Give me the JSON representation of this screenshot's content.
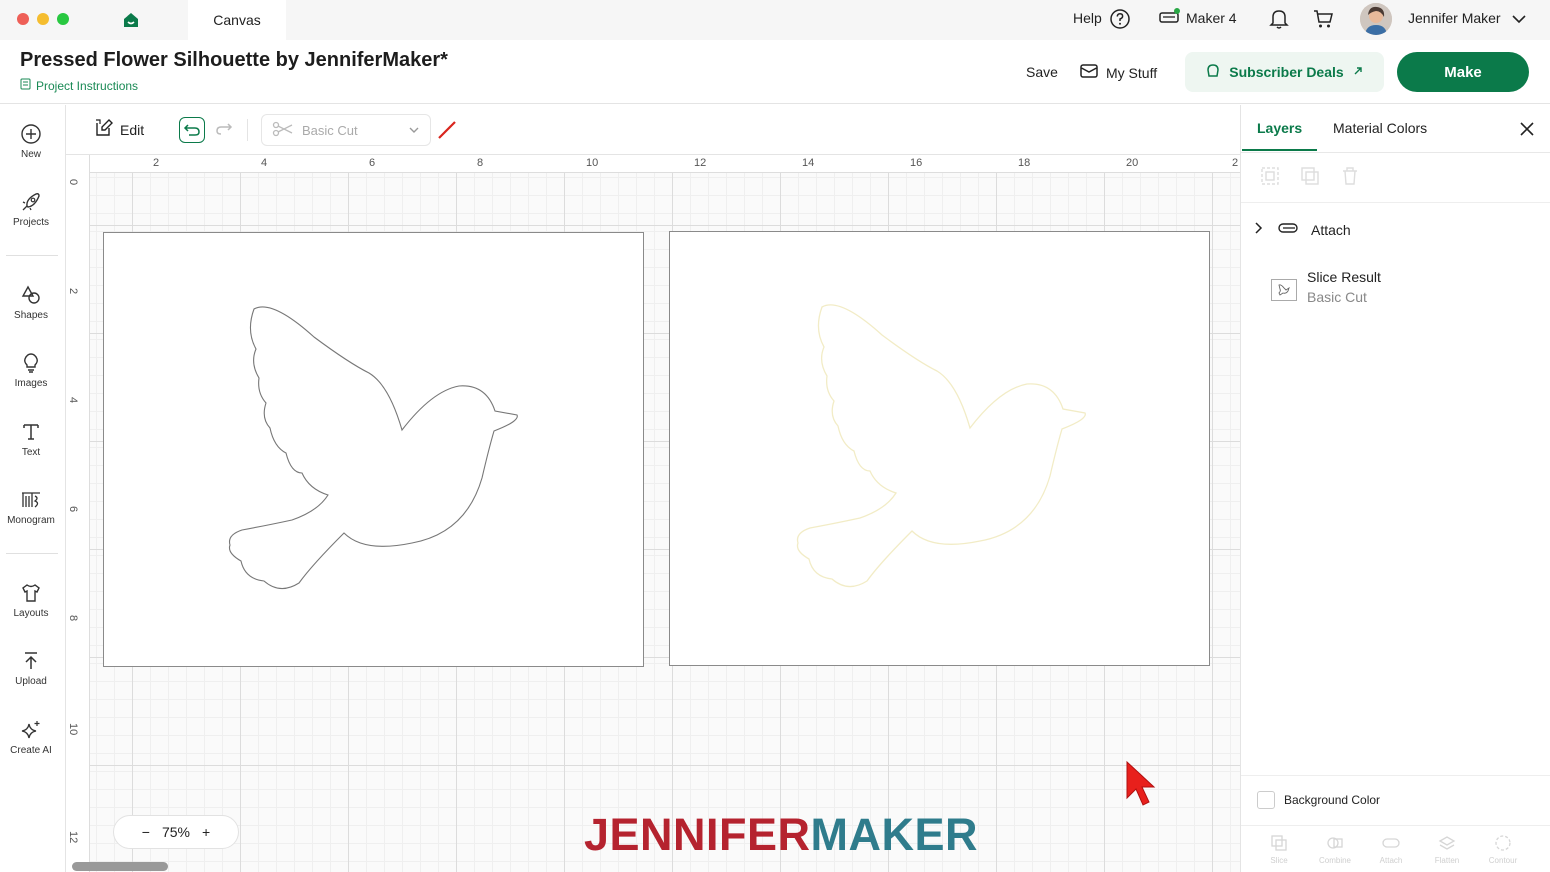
{
  "window": {
    "tab_label": "Canvas",
    "help_label": "Help",
    "machine_label": "Maker 4",
    "user_name": "Jennifer Maker"
  },
  "header": {
    "project_title": "Pressed Flower Silhouette by JenniferMaker*",
    "project_instructions": "Project Instructions",
    "save_label": "Save",
    "my_stuff_label": "My Stuff",
    "subscriber_deals_label": "Subscriber Deals",
    "make_label": "Make"
  },
  "sidebar": {
    "items": [
      {
        "label": "New",
        "icon": "plus-circle-icon"
      },
      {
        "label": "Projects",
        "icon": "rocket-icon"
      },
      {
        "label": "Shapes",
        "icon": "shapes-icon"
      },
      {
        "label": "Images",
        "icon": "lightbulb-icon"
      },
      {
        "label": "Text",
        "icon": "text-icon"
      },
      {
        "label": "Monogram",
        "icon": "monogram-icon"
      },
      {
        "label": "Layouts",
        "icon": "tshirt-icon"
      },
      {
        "label": "Upload",
        "icon": "upload-icon"
      },
      {
        "label": "Create AI",
        "icon": "sparkle-icon"
      }
    ]
  },
  "toolbar": {
    "edit_label": "Edit",
    "operation_value": "Basic Cut"
  },
  "canvas": {
    "ruler_top": [
      "2",
      "4",
      "6",
      "8",
      "10",
      "12",
      "14",
      "16",
      "18",
      "20",
      "2"
    ],
    "ruler_left": [
      "0",
      "2",
      "4",
      "6",
      "8",
      "10",
      "12"
    ],
    "zoom_label": "75%",
    "zoom_minus": "−",
    "zoom_plus": "+",
    "watermark_part1": "JENNIFER",
    "watermark_part2": "MAKER",
    "colors": {
      "accent": "#0b7a4a",
      "watermark_red": "#b5232f",
      "watermark_teal": "#2f7c8c",
      "bird_left_stroke": "#777777",
      "bird_right_stroke": "#f2ecc6"
    }
  },
  "right_panel": {
    "tab_layers": "Layers",
    "tab_material_colors": "Material Colors",
    "layers": [
      {
        "name": "Attach",
        "icon": "attach-icon"
      },
      {
        "name": "Slice Result",
        "operation": "Basic Cut"
      }
    ],
    "background_color_label": "Background Color",
    "bottom_tools": [
      "Slice",
      "Combine",
      "Attach",
      "Flatten",
      "Contour"
    ]
  }
}
